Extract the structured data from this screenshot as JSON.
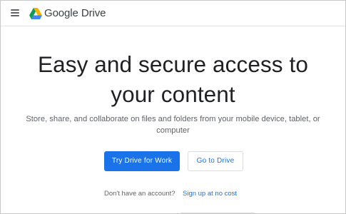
{
  "header": {
    "menu_icon": "hamburger-menu-icon",
    "logo_icon": "google-drive-logo-icon",
    "brand": "Google Drive"
  },
  "hero": {
    "title_line1": "Easy and secure access to",
    "title_line2": "your content",
    "subtitle": "Store, share, and collaborate on files and folders from your mobile device, tablet, or computer"
  },
  "actions": {
    "primary_label": "Try Drive for Work",
    "secondary_label": "Go to Drive"
  },
  "signup": {
    "prompt": "Don't have an account?",
    "link_label": "Sign up at no cost"
  },
  "colors": {
    "accent": "#1a73e8",
    "text_primary": "#202124",
    "text_secondary": "#5f6368",
    "drive_green": "#0f9d58",
    "drive_yellow": "#f4b400",
    "drive_blue": "#4285f4"
  }
}
